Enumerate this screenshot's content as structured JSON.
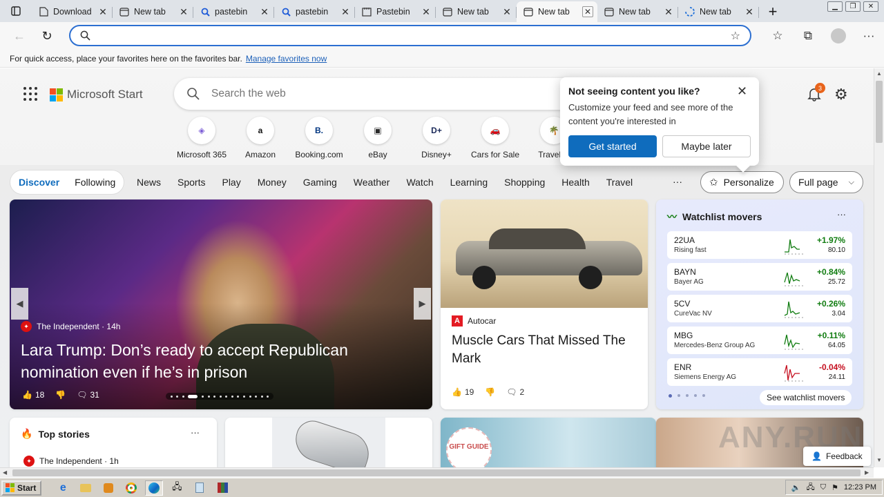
{
  "tabs": [
    {
      "title": "Download",
      "icon": "page-icon",
      "active": false
    },
    {
      "title": "New tab",
      "icon": "newtab-icon",
      "active": false
    },
    {
      "title": "pastebin",
      "icon": "search-icon",
      "active": false
    },
    {
      "title": "pastebin",
      "icon": "search-icon",
      "active": false
    },
    {
      "title": "Pastebin",
      "icon": "pastebin-icon",
      "active": false
    },
    {
      "title": "New tab",
      "icon": "newtab-icon",
      "active": false
    },
    {
      "title": "New tab",
      "icon": "newtab-icon",
      "active": true
    },
    {
      "title": "New tab",
      "icon": "newtab-icon",
      "active": false
    },
    {
      "title": "New tab",
      "icon": "loading-icon",
      "active": false
    }
  ],
  "address": {
    "value": "",
    "placeholder": ""
  },
  "favbar": {
    "text": "For quick access, place your favorites here on the favorites bar.",
    "link": "Manage favorites now"
  },
  "msn": {
    "brand": "Microsoft Start",
    "search_placeholder": "Search the web",
    "notification_count": "3",
    "quick_links": [
      {
        "label": "Microsoft 365",
        "glyph": "◈",
        "color": "#7b5cd6"
      },
      {
        "label": "Amazon",
        "glyph": "a",
        "color": "#111111"
      },
      {
        "label": "Booking.com",
        "glyph": "B.",
        "color": "#003580"
      },
      {
        "label": "eBay",
        "glyph": "▣",
        "color": "#2a2a2a"
      },
      {
        "label": "Disney+",
        "glyph": "D+",
        "color": "#1b2a5a"
      },
      {
        "label": "Cars for Sale",
        "glyph": "🚗",
        "color": "#d9372b"
      },
      {
        "label": "Travel Ic",
        "glyph": "🌴",
        "color": "#2b8a3e"
      }
    ],
    "nav": {
      "discover": "Discover",
      "following": "Following",
      "items": [
        "News",
        "Sports",
        "Play",
        "Money",
        "Gaming",
        "Weather",
        "Watch",
        "Learning",
        "Shopping",
        "Health",
        "Travel"
      ],
      "more": "···",
      "personalize": "Personalize",
      "fullpage": "Full page"
    },
    "hero": {
      "source": "The Independent · 14h",
      "headline": "Lara Trump: Don’s ready to accept Republican nomination even if he’s in prison",
      "likes": "18",
      "comments": "31"
    },
    "car_card": {
      "source": "Autocar",
      "headline": "Muscle Cars That Missed The Mark",
      "likes": "19",
      "comments": "2"
    },
    "watchlist": {
      "title": "Watchlist movers",
      "rows": [
        {
          "ticker": "22UA",
          "name": "Rising fast",
          "change": "+1.97%",
          "price": "80.10",
          "up": true
        },
        {
          "ticker": "BAYN",
          "name": "Bayer AG",
          "change": "+0.84%",
          "price": "25.72",
          "up": true
        },
        {
          "ticker": "5CV",
          "name": "CureVac NV",
          "change": "+0.26%",
          "price": "3.04",
          "up": true
        },
        {
          "ticker": "MBG",
          "name": "Mercedes-Benz Group AG",
          "change": "+0.11%",
          "price": "64.05",
          "up": true
        },
        {
          "ticker": "ENR",
          "name": "Siemens Energy AG",
          "change": "-0.04%",
          "price": "24.11",
          "up": false
        }
      ],
      "see_more": "See watchlist movers"
    },
    "top_stories": {
      "title": "Top stories",
      "source": "The Independent · 1h"
    },
    "gift_badge": "GIFT GUIDE",
    "feedback": "Feedback"
  },
  "popup": {
    "title": "Not seeing content you like?",
    "body": "Customize your feed and see more of the content you're interested in",
    "primary": "Get started",
    "secondary": "Maybe later"
  },
  "taskbar": {
    "start": "Start",
    "time": "12:23 PM"
  },
  "watermark": "ANY.RUN"
}
